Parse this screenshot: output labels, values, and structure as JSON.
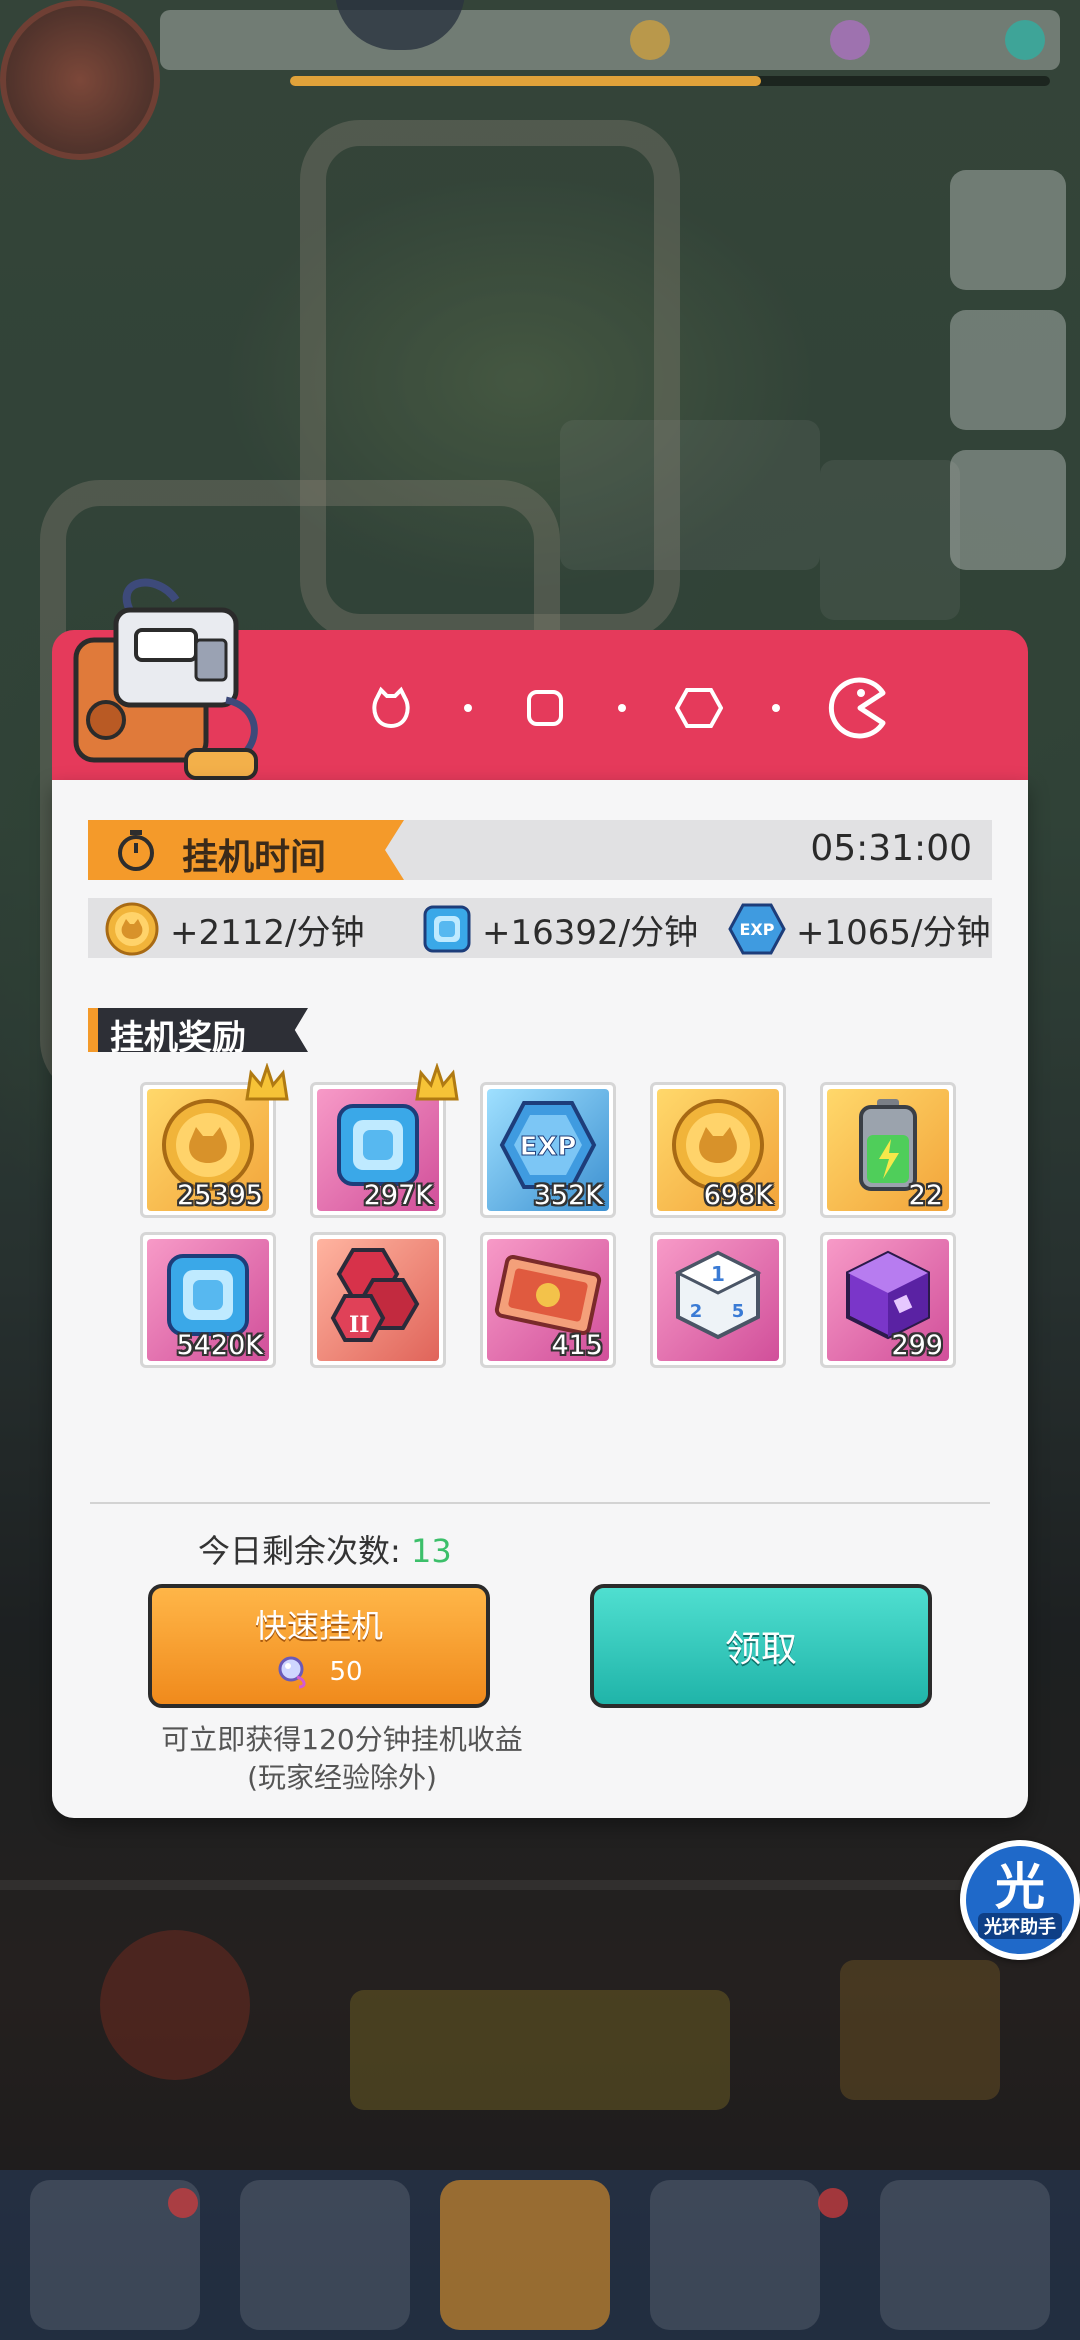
{
  "dialog": {
    "idle_time_label": "挂机时间",
    "idle_time_value": "05:31:00",
    "rates": [
      {
        "icon": "gold-coin-icon",
        "text": "+2112/分钟"
      },
      {
        "icon": "blue-gem-icon",
        "text": "+16392/分钟"
      },
      {
        "icon": "exp-badge-icon",
        "text": "+1065/分钟"
      }
    ],
    "rewards_title": "挂机奖励",
    "rewards": [
      {
        "icon": "gold-coin-icon",
        "qty": "25395",
        "crown": true
      },
      {
        "icon": "blue-gem-icon",
        "qty": "297K",
        "crown": true
      },
      {
        "icon": "exp-badge-icon",
        "qty": "352K",
        "crown": false
      },
      {
        "icon": "gold-coin-icon",
        "qty": "698K",
        "crown": false
      },
      {
        "icon": "battery-icon",
        "qty": "22",
        "crown": false
      },
      {
        "icon": "blue-gem-icon",
        "qty": "5420K",
        "crown": false
      },
      {
        "icon": "red-hexagon-token-icon",
        "qty": "",
        "crown": false
      },
      {
        "icon": "treasure-card-icon",
        "qty": "415",
        "crown": false
      },
      {
        "icon": "dice-icon",
        "qty": "",
        "crown": false
      },
      {
        "icon": "purple-cube-icon",
        "qty": "299",
        "crown": false
      }
    ],
    "remaining_label": "今日剩余次数:",
    "remaining_count": "13",
    "fast_idle_button": "快速挂机",
    "fast_idle_cost": "50",
    "claim_button": "领取",
    "note_line1": "可立即获得120分钟挂机收益",
    "note_line2": "(玩家经验除外)"
  },
  "helper": {
    "glyph": "光",
    "label": "光环助手"
  },
  "colors": {
    "header": "#e53a5b",
    "accent_orange": "#f49a2a",
    "claim_teal": "#2cc3b8",
    "remaining_green": "#3cbf6a"
  }
}
